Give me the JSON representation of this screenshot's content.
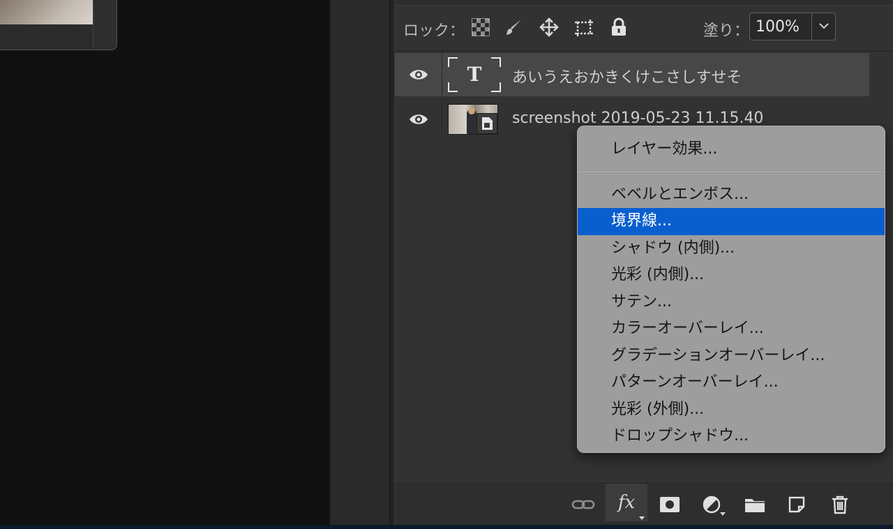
{
  "lock": {
    "label": "ロック：",
    "icons": [
      "transparency-lock-icon",
      "brush-lock-icon",
      "move-lock-icon",
      "artboard-lock-icon",
      "padlock-icon"
    ]
  },
  "fill": {
    "label": "塗り：",
    "value": "100%"
  },
  "layers": [
    {
      "name": "あいうえおかきくけこさしすせそ",
      "type": "text",
      "visible": true,
      "selected": true
    },
    {
      "name": "screenshot 2019-05-23 11.15.40",
      "type": "smart-object",
      "visible": true,
      "selected": false
    }
  ],
  "text_thumb_glyph": "T",
  "context_menu": {
    "header": "レイヤー効果...",
    "items": [
      "ベベルとエンボス...",
      "境界線...",
      "シャドウ (内側)...",
      "光彩 (内側)...",
      "サテン...",
      "カラーオーバーレイ...",
      "グラデーションオーバーレイ...",
      "パターンオーバーレイ...",
      "光彩 (外側)...",
      "ドロップシャドウ..."
    ],
    "highlighted": "境界線..."
  },
  "bottom_toolbar": {
    "fx_label": "fx",
    "icons": [
      "link-layers-icon",
      "fx-icon",
      "add-mask-icon",
      "adjustment-layer-icon",
      "new-group-icon",
      "new-layer-icon",
      "delete-layer-icon"
    ]
  },
  "colors": {
    "highlight": "#0a5fcf",
    "menu_bg": "#9d9d9d",
    "panel_bg": "#323232"
  }
}
